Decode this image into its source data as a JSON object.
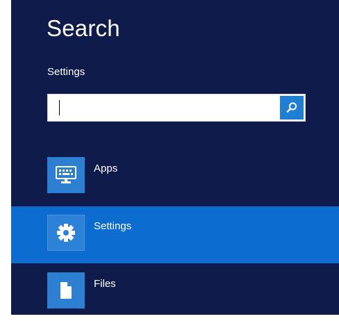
{
  "pane": {
    "title": "Search",
    "scope_label": "Settings"
  },
  "search": {
    "value": "",
    "placeholder": "",
    "button_icon": "search-icon"
  },
  "results": [
    {
      "label": "Apps",
      "icon": "apps-keyboard-icon",
      "selected": false
    },
    {
      "label": "Settings",
      "icon": "gear-icon",
      "selected": true
    },
    {
      "label": "Files",
      "icon": "document-icon",
      "selected": false
    }
  ],
  "colors": {
    "pane_background": "#0f1c4b",
    "selected_row": "#0c6ccf",
    "icon_tile": "#2d7fd1",
    "search_button": "#1f7fd4"
  }
}
